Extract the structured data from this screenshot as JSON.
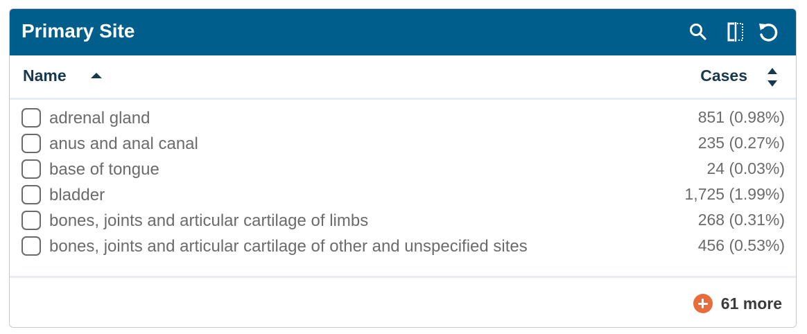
{
  "panel": {
    "title": "Primary Site",
    "icons": [
      "search-icon",
      "compare-columns-icon",
      "reset-icon"
    ]
  },
  "columns": {
    "name_label": "Name",
    "name_sort": "ascending",
    "cases_label": "Cases",
    "cases_sort": "unsorted"
  },
  "rows": [
    {
      "name": "adrenal gland",
      "count": "851 (0.98%)",
      "checked": false
    },
    {
      "name": "anus and anal canal",
      "count": "235 (0.27%)",
      "checked": false
    },
    {
      "name": "base of tongue",
      "count": "24 (0.03%)",
      "checked": false
    },
    {
      "name": "bladder",
      "count": "1,725 (1.99%)",
      "checked": false
    },
    {
      "name": "bones, joints and articular cartilage of limbs",
      "count": "268 (0.31%)",
      "checked": false
    },
    {
      "name": "bones, joints and articular cartilage of other and unspecified sites",
      "count": "456 (0.53%)",
      "checked": false
    }
  ],
  "footer": {
    "more_label": "61 more",
    "accent_color": "#e86d3c"
  },
  "colors": {
    "header_bg": "#005e8c",
    "header_text": "#ffffff",
    "column_text": "#17394d",
    "row_text": "#6b6b6b"
  }
}
